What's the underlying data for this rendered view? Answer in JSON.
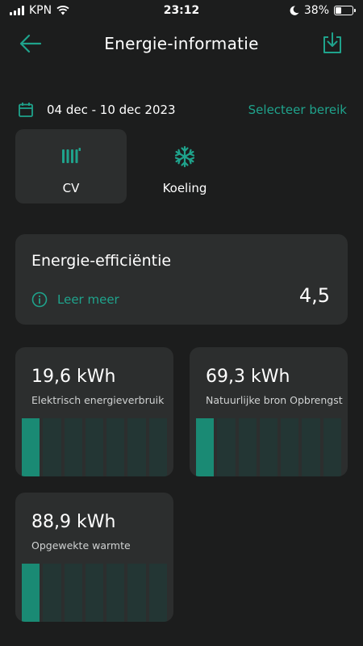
{
  "status_bar": {
    "carrier": "KPN",
    "time": "23:12",
    "battery_percent": "38%",
    "battery_level": 0.38
  },
  "header": {
    "title": "Energie-informatie",
    "back_icon": "arrow-left-icon",
    "download_icon": "download-icon"
  },
  "date_range": {
    "text": "04 dec - 10 dec 2023",
    "select_label": "Selecteer bereik",
    "icon": "calendar-icon"
  },
  "tabs": [
    {
      "label": "CV",
      "icon": "radiator-icon",
      "active": true
    },
    {
      "label": "Koeling",
      "icon": "snowflake-icon",
      "active": false
    }
  ],
  "efficiency": {
    "title": "Energie-efficiëntie",
    "learn_more": "Leer meer",
    "value": "4,5"
  },
  "cards": [
    {
      "value": "19,6 kWh",
      "label": "Elektrisch energieverbruik",
      "bars": [
        1,
        0,
        0,
        0,
        0,
        0,
        0
      ]
    },
    {
      "value": "69,3 kWh",
      "label": "Natuurlijke bron Opbrengst",
      "bars": [
        1,
        0,
        0,
        0,
        0,
        0,
        0
      ]
    },
    {
      "value": "88,9 kWh",
      "label": "Opgewekte warmte",
      "bars": [
        1,
        0,
        0,
        0,
        0,
        0,
        0
      ]
    }
  ],
  "colors": {
    "background": "#1c1d1d",
    "card": "#2c2e2e",
    "accent": "#1fa38c",
    "bar_fill": "#1a8a74",
    "bar_empty": "#233634"
  }
}
